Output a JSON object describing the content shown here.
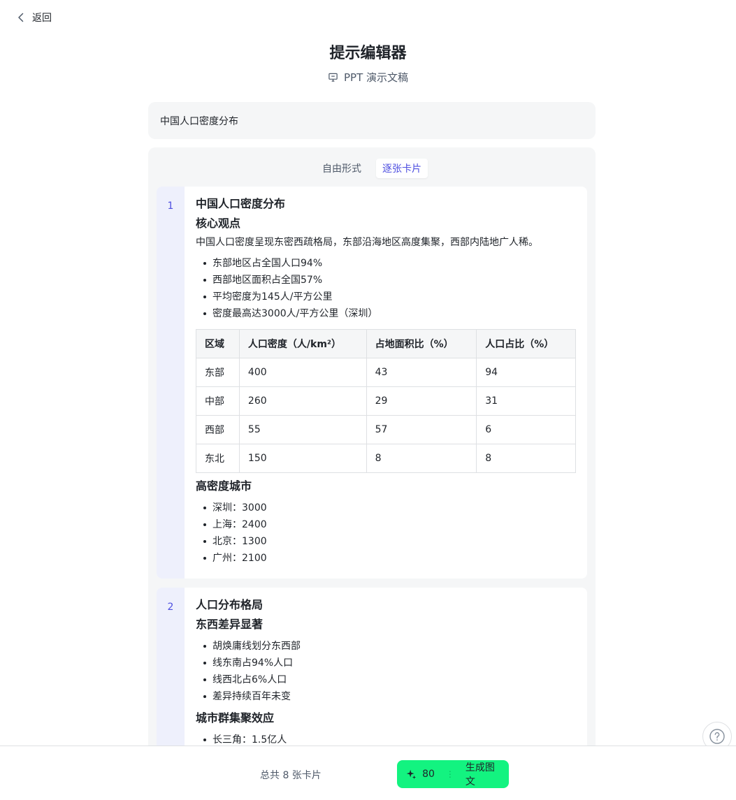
{
  "nav": {
    "back_label": "返回"
  },
  "header": {
    "title": "提示编辑器",
    "subtitle": "PPT 演示文稿"
  },
  "topic": {
    "value": "中国人口密度分布"
  },
  "modes": [
    {
      "label": "自由形式",
      "active": false
    },
    {
      "label": "逐张卡片",
      "active": true
    }
  ],
  "cards": [
    {
      "number": "1",
      "title": "中国人口密度分布",
      "section1_heading": "核心观点",
      "paragraph": "中国人口密度呈现东密西疏格局，东部沿海地区高度集聚，西部内陆地广人稀。",
      "bullets1": [
        "东部地区占全国人口94%",
        "西部地区面积占全国57%",
        "平均密度为145人/平方公里",
        "密度最高达3000人/平方公里（深圳）"
      ],
      "table": {
        "headers": [
          "区域",
          "人口密度（人/km²）",
          "占地面积比（%）",
          "人口占比（%）"
        ],
        "rows": [
          [
            "东部",
            "400",
            "43",
            "94"
          ],
          [
            "中部",
            "260",
            "29",
            "31"
          ],
          [
            "西部",
            "55",
            "57",
            "6"
          ],
          [
            "东北",
            "150",
            "8",
            "8"
          ]
        ]
      },
      "section2_heading": "高密度城市",
      "bullets2": [
        "深圳：3000",
        "上海：2400",
        "北京：1300",
        "广州：2100"
      ]
    },
    {
      "number": "2",
      "title": "人口分布格局",
      "section1_heading": "东西差异显著",
      "bullets1": [
        "胡焕庸线划分东西部",
        "线东南占94%人口",
        "线西北占6%人口",
        "差异持续百年未变"
      ],
      "section2_heading": "城市群集聚效应",
      "bullets2": [
        "长三角：1.5亿人"
      ]
    }
  ],
  "footer": {
    "count_label": "总共 8 张卡片",
    "credits": "80",
    "generate_label": "生成图文"
  },
  "colors": {
    "accent": "#4e4fe0",
    "generate": "#13f380",
    "panel": "#f5f6f7"
  },
  "icons": {
    "back": "chevron-left-icon",
    "ppt": "presentation-icon",
    "help": "question-icon",
    "generate": "sparkle-icon"
  }
}
